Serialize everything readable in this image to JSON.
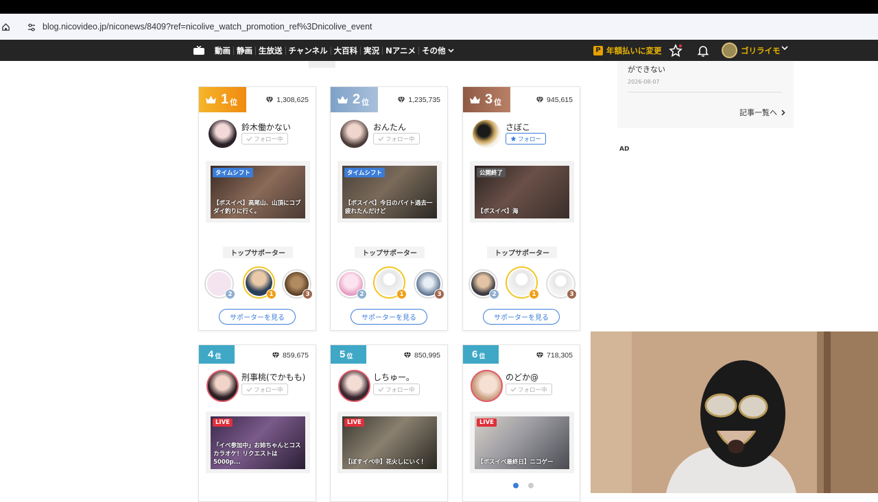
{
  "browser": {
    "url": "blog.nicovideo.jp/niconews/8409?ref=nicolive_watch_promotion_ref%3Dnicolive_event"
  },
  "nav": {
    "items": [
      "動画",
      "静画",
      "生放送",
      "チャンネル",
      "大百科",
      "実況",
      "Nアニメ"
    ],
    "more": "その他",
    "premium_badge": "P",
    "premium": "年額払いに変更",
    "username": "ゴリライモ"
  },
  "side": {
    "text": "ができない",
    "date": "2026-08-07",
    "more": "記事一覧へ",
    "ad": "AD"
  },
  "ranking": [
    {
      "rank": "1",
      "pos": "位",
      "points": "1,308,625",
      "name": "鈴木働かない",
      "follow": "フォロー中",
      "following": true,
      "tag": "タイムシフト",
      "title": "【ボスイベ】高尾山、山頂にコブダイ釣りに行く。",
      "supporters_label": "トップサポーター",
      "supporter_ranks": [
        "2",
        "1",
        "3"
      ],
      "see_supporters": "サポーターを見る"
    },
    {
      "rank": "2",
      "pos": "位",
      "points": "1,235,735",
      "name": "おんたん",
      "follow": "フォロー中",
      "following": true,
      "tag": "タイムシフト",
      "title": "【ボスイベ】今日のバイト過去一疲れたんだけど",
      "supporters_label": "トップサポーター",
      "supporter_ranks": [
        "2",
        "1",
        "3"
      ],
      "see_supporters": "サポーターを見る"
    },
    {
      "rank": "3",
      "pos": "位",
      "points": "945,615",
      "name": "さぼこ",
      "follow": "フォロー",
      "following": false,
      "tag": "公開終了",
      "title": "【ボスイベ】海",
      "supporters_label": "トップサポーター",
      "supporter_ranks": [
        "2",
        "1",
        "3"
      ],
      "see_supporters": "サポーターを見る"
    },
    {
      "rank": "4",
      "pos": "位",
      "points": "859,675",
      "name": "刑事桃(でかもも)",
      "follow": "フォロー中",
      "following": true,
      "tag": "LIVE",
      "title": "「イベ参加中」お姉ちゃんとコスカラオケ！リクエストは5000p..."
    },
    {
      "rank": "5",
      "pos": "位",
      "points": "850,995",
      "name": "しちゅー。",
      "follow": "フォロー中",
      "following": true,
      "tag": "LIVE",
      "title": "【ぼすイベ中】花火しにいく！"
    },
    {
      "rank": "6",
      "pos": "位",
      "points": "718,305",
      "name": "のどか@",
      "follow": "フォロー中",
      "following": true,
      "tag": "LIVE",
      "title": "【ボスイベ最終日】ニコゲー"
    }
  ],
  "colors": {
    "gold": "#f0a019",
    "silver": "#7fa1c7",
    "bronze": "#a0684e",
    "teal": "#3fa8c6",
    "blue": "#3b7dd8",
    "live": "#e0303a",
    "nav": "#252525"
  }
}
